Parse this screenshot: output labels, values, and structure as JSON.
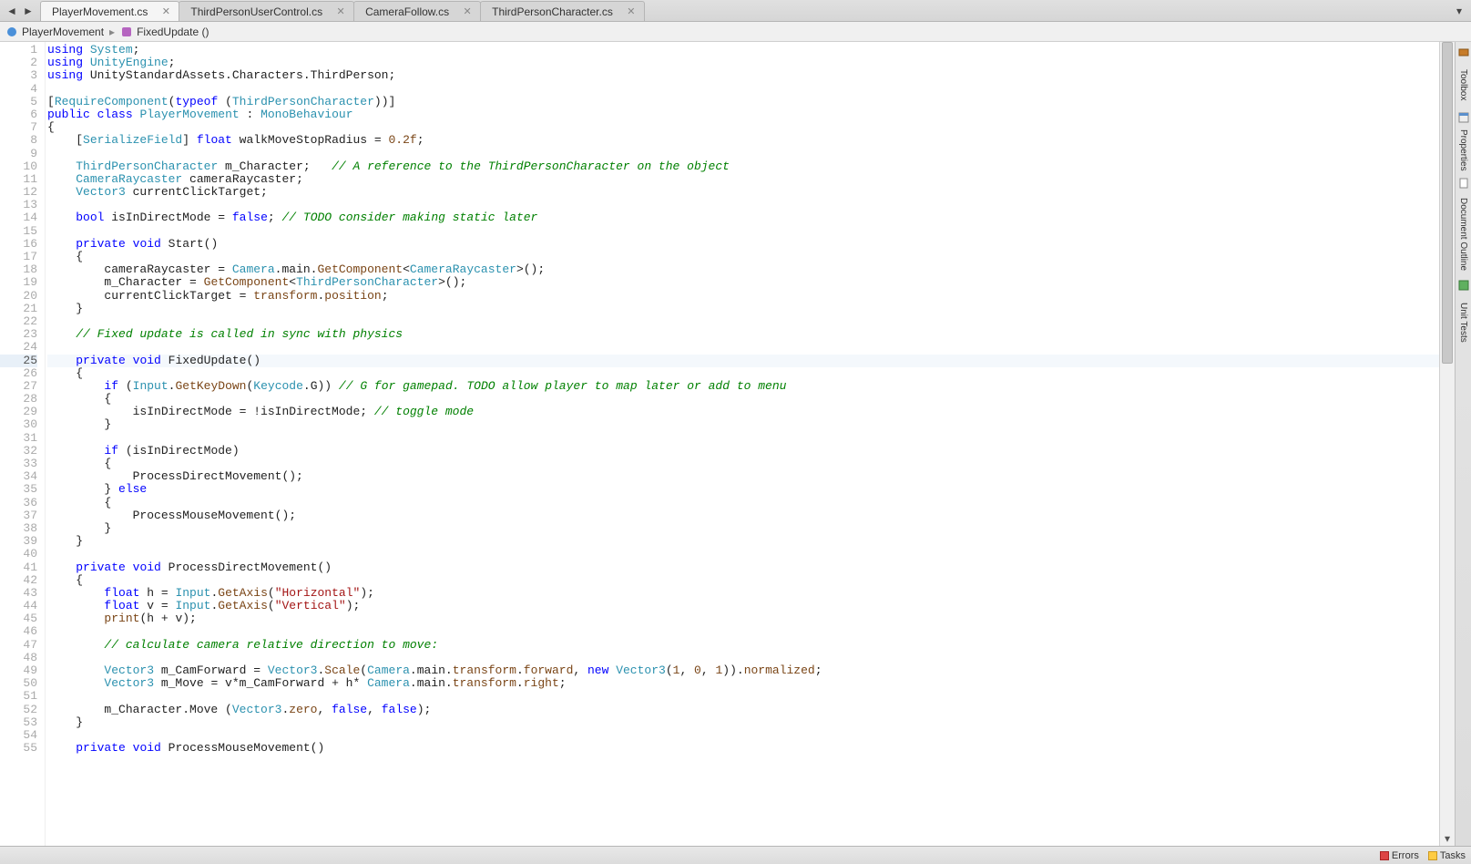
{
  "tabs": [
    {
      "label": "PlayerMovement.cs",
      "active": true
    },
    {
      "label": "ThirdPersonUserControl.cs",
      "active": false
    },
    {
      "label": "CameraFollow.cs",
      "active": false
    },
    {
      "label": "ThirdPersonCharacter.cs",
      "active": false
    }
  ],
  "breadcrumb": {
    "item1": "PlayerMovement",
    "item2": "FixedUpdate ()"
  },
  "side_rail": {
    "toolbox": "Toolbox",
    "properties": "Properties",
    "doc_outline": "Document Outline",
    "unit_tests": "Unit Tests"
  },
  "status": {
    "errors": "Errors",
    "tasks": "Tasks"
  },
  "active_line": 25,
  "code": [
    {
      "n": 1,
      "tokens": [
        [
          "k",
          "using"
        ],
        [
          " "
        ],
        [
          "t",
          "System"
        ],
        [
          ";"
        ]
      ]
    },
    {
      "n": 2,
      "tokens": [
        [
          "k",
          "using"
        ],
        [
          " "
        ],
        [
          "t",
          "UnityEngine"
        ],
        [
          ";"
        ]
      ]
    },
    {
      "n": 3,
      "tokens": [
        [
          "k",
          "using"
        ],
        [
          " UnityStandardAssets.Characters.ThirdPerson;"
        ]
      ]
    },
    {
      "n": 4,
      "tokens": []
    },
    {
      "n": 5,
      "tokens": [
        [
          "",
          ""
        ],
        [
          "",
          "["
        ],
        [
          "t",
          "RequireComponent"
        ],
        [
          "",
          "("
        ],
        [
          "k",
          "typeof"
        ],
        [
          " ("
        ],
        [
          "t",
          "ThirdPersonCharacter"
        ],
        [
          "",
          "))]"
        ]
      ]
    },
    {
      "n": 6,
      "tokens": [
        [
          "k",
          "public"
        ],
        [
          " "
        ],
        [
          "k",
          "class"
        ],
        [
          " "
        ],
        [
          "t",
          "PlayerMovement"
        ],
        [
          " : "
        ],
        [
          "t",
          "MonoBehaviour"
        ]
      ]
    },
    {
      "n": 7,
      "tokens": [
        [
          "",
          "{"
        ]
      ]
    },
    {
      "n": 8,
      "tokens": [
        [
          "",
          "    ["
        ],
        [
          "t",
          "SerializeField"
        ],
        [
          "",
          "] "
        ],
        [
          "k",
          "float"
        ],
        [
          " walkMoveStopRadius = "
        ],
        [
          "n",
          "0.2f"
        ],
        [
          ";"
        ]
      ]
    },
    {
      "n": 9,
      "tokens": []
    },
    {
      "n": 10,
      "tokens": [
        [
          "",
          "    "
        ],
        [
          "t",
          "ThirdPersonCharacter"
        ],
        [
          " m_Character;   "
        ],
        [
          "c",
          "// A reference to the ThirdPersonCharacter on the object"
        ]
      ]
    },
    {
      "n": 11,
      "tokens": [
        [
          "",
          "    "
        ],
        [
          "t",
          "CameraRaycaster"
        ],
        [
          " cameraRaycaster;"
        ]
      ]
    },
    {
      "n": 12,
      "tokens": [
        [
          "",
          "    "
        ],
        [
          "t",
          "Vector3"
        ],
        [
          " currentClickTarget;"
        ]
      ]
    },
    {
      "n": 13,
      "tokens": []
    },
    {
      "n": 14,
      "tokens": [
        [
          "",
          "    "
        ],
        [
          "k",
          "bool"
        ],
        [
          " isInDirectMode = "
        ],
        [
          "k",
          "false"
        ],
        [
          "; "
        ],
        [
          "c",
          "// TODO"
        ],
        [
          " "
        ],
        [
          "c",
          "consider making static later"
        ]
      ]
    },
    {
      "n": 15,
      "tokens": []
    },
    {
      "n": 16,
      "tokens": [
        [
          "",
          "    "
        ],
        [
          "k",
          "private"
        ],
        [
          " "
        ],
        [
          "k",
          "void"
        ],
        [
          " Start()"
        ]
      ]
    },
    {
      "n": 17,
      "tokens": [
        [
          "",
          "    {"
        ]
      ]
    },
    {
      "n": 18,
      "tokens": [
        [
          "",
          "        cameraRaycaster = "
        ],
        [
          "t",
          "Camera"
        ],
        [
          ".main."
        ],
        [
          "a",
          "GetComponent"
        ],
        [
          "<"
        ],
        [
          "t",
          "CameraRaycaster"
        ],
        [
          ">();"
        ]
      ]
    },
    {
      "n": 19,
      "tokens": [
        [
          "",
          "        m_Character = "
        ],
        [
          "a",
          "GetComponent"
        ],
        [
          "<"
        ],
        [
          "t",
          "ThirdPersonCharacter"
        ],
        [
          ">();"
        ]
      ]
    },
    {
      "n": 20,
      "tokens": [
        [
          "",
          "        currentClickTarget = "
        ],
        [
          "a",
          "transform"
        ],
        [
          "."
        ],
        [
          "a",
          "position"
        ],
        [
          ";"
        ]
      ]
    },
    {
      "n": 21,
      "tokens": [
        [
          "",
          "    }"
        ]
      ]
    },
    {
      "n": 22,
      "tokens": []
    },
    {
      "n": 23,
      "tokens": [
        [
          "",
          "    "
        ],
        [
          "c",
          "// Fixed update is called in sync with physics"
        ]
      ]
    },
    {
      "n": 24,
      "tokens": []
    },
    {
      "n": 25,
      "tokens": [
        [
          "",
          "    "
        ],
        [
          "k",
          "private"
        ],
        [
          " "
        ],
        [
          "k",
          "void"
        ],
        [
          " FixedUpdate()"
        ]
      ]
    },
    {
      "n": 26,
      "tokens": [
        [
          "",
          "    {"
        ]
      ]
    },
    {
      "n": 27,
      "tokens": [
        [
          "",
          "        "
        ],
        [
          "k",
          "if"
        ],
        [
          " ("
        ],
        [
          "t",
          "Input"
        ],
        [
          "."
        ],
        [
          "a",
          "GetKeyDown"
        ],
        [
          "("
        ],
        [
          "t",
          "Keycode"
        ],
        [
          ".G)) "
        ],
        [
          "c",
          "// G for gamepad."
        ],
        [
          " "
        ],
        [
          "c",
          "TODO"
        ],
        [
          " "
        ],
        [
          "c",
          "allow player to map later or add to menu"
        ]
      ]
    },
    {
      "n": 28,
      "tokens": [
        [
          "",
          "        {"
        ]
      ]
    },
    {
      "n": 29,
      "tokens": [
        [
          "",
          "            isInDirectMode = !isInDirectMode; "
        ],
        [
          "c",
          "// toggle mode"
        ]
      ]
    },
    {
      "n": 30,
      "tokens": [
        [
          "",
          "        }"
        ]
      ]
    },
    {
      "n": 31,
      "tokens": []
    },
    {
      "n": 32,
      "tokens": [
        [
          "",
          "        "
        ],
        [
          "k",
          "if"
        ],
        [
          " (isInDirectMode)"
        ]
      ]
    },
    {
      "n": 33,
      "tokens": [
        [
          "",
          "        {"
        ]
      ]
    },
    {
      "n": 34,
      "tokens": [
        [
          "",
          "            ProcessDirectMovement();"
        ]
      ]
    },
    {
      "n": 35,
      "tokens": [
        [
          "",
          "        } "
        ],
        [
          "k",
          "else"
        ]
      ]
    },
    {
      "n": 36,
      "tokens": [
        [
          "",
          "        {"
        ]
      ]
    },
    {
      "n": 37,
      "tokens": [
        [
          "",
          "            ProcessMouseMovement();"
        ]
      ]
    },
    {
      "n": 38,
      "tokens": [
        [
          "",
          "        }"
        ]
      ]
    },
    {
      "n": 39,
      "tokens": [
        [
          "",
          "    }"
        ]
      ]
    },
    {
      "n": 40,
      "tokens": []
    },
    {
      "n": 41,
      "tokens": [
        [
          "",
          "    "
        ],
        [
          "k",
          "private"
        ],
        [
          " "
        ],
        [
          "k",
          "void"
        ],
        [
          " ProcessDirectMovement()"
        ]
      ]
    },
    {
      "n": 42,
      "tokens": [
        [
          "",
          "    {"
        ]
      ]
    },
    {
      "n": 43,
      "tokens": [
        [
          "",
          "        "
        ],
        [
          "k",
          "float"
        ],
        [
          " h = "
        ],
        [
          "t",
          "Input"
        ],
        [
          "."
        ],
        [
          "a",
          "GetAxis"
        ],
        [
          "("
        ],
        [
          "s",
          "\"Horizontal\""
        ],
        [
          ");"
        ]
      ]
    },
    {
      "n": 44,
      "tokens": [
        [
          "",
          "        "
        ],
        [
          "k",
          "float"
        ],
        [
          " v = "
        ],
        [
          "t",
          "Input"
        ],
        [
          "."
        ],
        [
          "a",
          "GetAxis"
        ],
        [
          "("
        ],
        [
          "s",
          "\"Vertical\""
        ],
        [
          ");"
        ]
      ]
    },
    {
      "n": 45,
      "tokens": [
        [
          "",
          "        "
        ],
        [
          "a",
          "print"
        ],
        [
          "(h + v);"
        ]
      ]
    },
    {
      "n": 46,
      "tokens": []
    },
    {
      "n": 47,
      "tokens": [
        [
          "",
          "        "
        ],
        [
          "c",
          "// calculate camera relative direction to move:"
        ]
      ]
    },
    {
      "n": 48,
      "tokens": []
    },
    {
      "n": 49,
      "tokens": [
        [
          "",
          "        "
        ],
        [
          "t",
          "Vector3"
        ],
        [
          " m_CamForward = "
        ],
        [
          "t",
          "Vector3"
        ],
        [
          "."
        ],
        [
          "a",
          "Scale"
        ],
        [
          "("
        ],
        [
          "t",
          "Camera"
        ],
        [
          ".main."
        ],
        [
          "a",
          "transform"
        ],
        [
          "."
        ],
        [
          "a",
          "forward"
        ],
        [
          ", "
        ],
        [
          "k",
          "new"
        ],
        [
          " "
        ],
        [
          "t",
          "Vector3"
        ],
        [
          "("
        ],
        [
          "n",
          "1"
        ],
        [
          ", "
        ],
        [
          "n",
          "0"
        ],
        [
          ", "
        ],
        [
          "n",
          "1"
        ],
        [
          "))."
        ],
        [
          "a",
          "normalized"
        ],
        [
          ";"
        ]
      ]
    },
    {
      "n": 50,
      "tokens": [
        [
          "",
          "        "
        ],
        [
          "t",
          "Vector3"
        ],
        [
          " m_Move = v*m_CamForward + h* "
        ],
        [
          "t",
          "Camera"
        ],
        [
          ".main."
        ],
        [
          "a",
          "transform"
        ],
        [
          "."
        ],
        [
          "a",
          "right"
        ],
        [
          ";"
        ]
      ]
    },
    {
      "n": 51,
      "tokens": []
    },
    {
      "n": 52,
      "tokens": [
        [
          "",
          "        m_Character.Move ("
        ],
        [
          "t",
          "Vector3"
        ],
        [
          "."
        ],
        [
          "a",
          "zero"
        ],
        [
          ", "
        ],
        [
          "k",
          "false"
        ],
        [
          ", "
        ],
        [
          "k",
          "false"
        ],
        [
          ");"
        ]
      ]
    },
    {
      "n": 53,
      "tokens": [
        [
          "",
          "    }"
        ]
      ]
    },
    {
      "n": 54,
      "tokens": []
    },
    {
      "n": 55,
      "tokens": [
        [
          "",
          "    "
        ],
        [
          "k",
          "private"
        ],
        [
          " "
        ],
        [
          "k",
          "void"
        ],
        [
          " ProcessMouseMovement()"
        ]
      ]
    }
  ]
}
